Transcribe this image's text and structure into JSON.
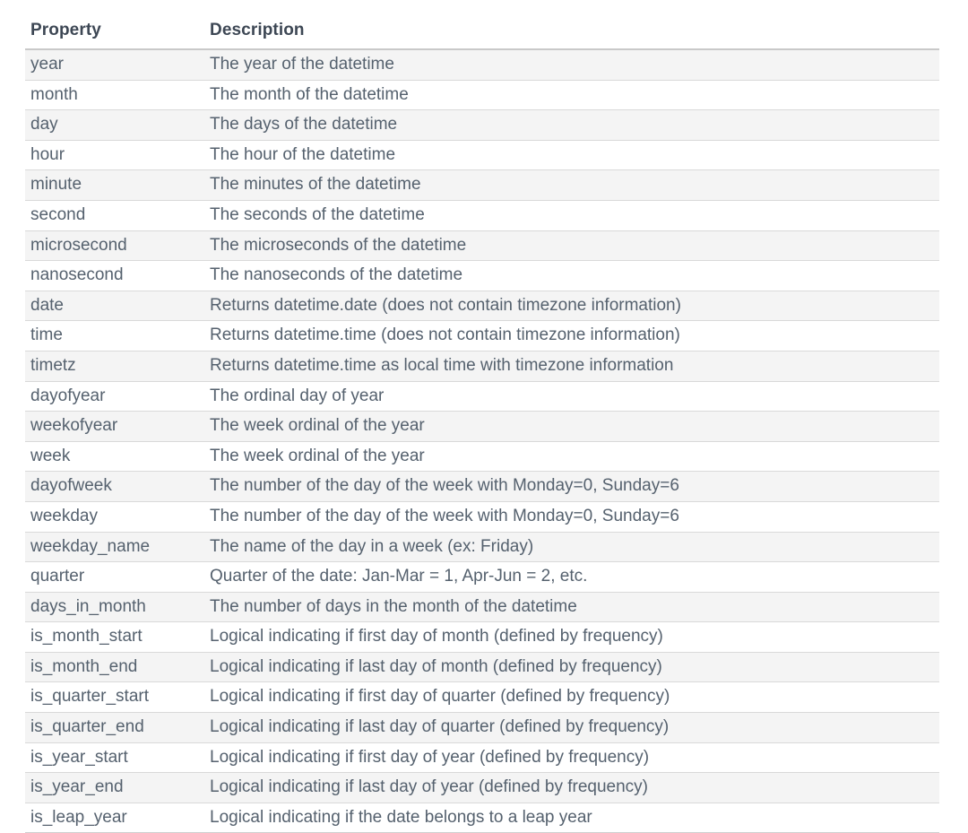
{
  "table": {
    "columns": [
      {
        "key": "property",
        "label": "Property"
      },
      {
        "key": "description",
        "label": "Description"
      }
    ],
    "rows": [
      {
        "property": "year",
        "description": "The year of the datetime"
      },
      {
        "property": "month",
        "description": "The month of the datetime"
      },
      {
        "property": "day",
        "description": "The days of the datetime"
      },
      {
        "property": "hour",
        "description": "The hour of the datetime"
      },
      {
        "property": "minute",
        "description": "The minutes of the datetime"
      },
      {
        "property": "second",
        "description": "The seconds of the datetime"
      },
      {
        "property": "microsecond",
        "description": "The microseconds of the datetime"
      },
      {
        "property": "nanosecond",
        "description": "The nanoseconds of the datetime"
      },
      {
        "property": "date",
        "description": "Returns datetime.date (does not contain timezone information)"
      },
      {
        "property": "time",
        "description": "Returns datetime.time (does not contain timezone information)"
      },
      {
        "property": "timetz",
        "description": "Returns datetime.time as local time with timezone information"
      },
      {
        "property": "dayofyear",
        "description": "The ordinal day of year"
      },
      {
        "property": "weekofyear",
        "description": "The week ordinal of the year"
      },
      {
        "property": "week",
        "description": "The week ordinal of the year"
      },
      {
        "property": "dayofweek",
        "description": "The number of the day of the week with Monday=0, Sunday=6"
      },
      {
        "property": "weekday",
        "description": "The number of the day of the week with Monday=0, Sunday=6"
      },
      {
        "property": "weekday_name",
        "description": "The name of the day in a week (ex: Friday)"
      },
      {
        "property": "quarter",
        "description": "Quarter of the date: Jan-Mar = 1, Apr-Jun = 2, etc."
      },
      {
        "property": "days_in_month",
        "description": "The number of days in the month of the datetime"
      },
      {
        "property": "is_month_start",
        "description": "Logical indicating if first day of month (defined by frequency)"
      },
      {
        "property": "is_month_end",
        "description": "Logical indicating if last day of month (defined by frequency)"
      },
      {
        "property": "is_quarter_start",
        "description": "Logical indicating if first day of quarter (defined by frequency)"
      },
      {
        "property": "is_quarter_end",
        "description": "Logical indicating if last day of quarter (defined by frequency)"
      },
      {
        "property": "is_year_start",
        "description": "Logical indicating if first day of year (defined by frequency)"
      },
      {
        "property": "is_year_end",
        "description": "Logical indicating if last day of year (defined by frequency)"
      },
      {
        "property": "is_leap_year",
        "description": "Logical indicating if the date belongs to a leap year"
      }
    ]
  },
  "colors": {
    "header_text": "#3d4754",
    "body_text": "#55616e",
    "stripe": "#f4f4f4",
    "rule": "#d9d9d9",
    "header_rule": "#c9c9c9",
    "background": "#ffffff"
  }
}
